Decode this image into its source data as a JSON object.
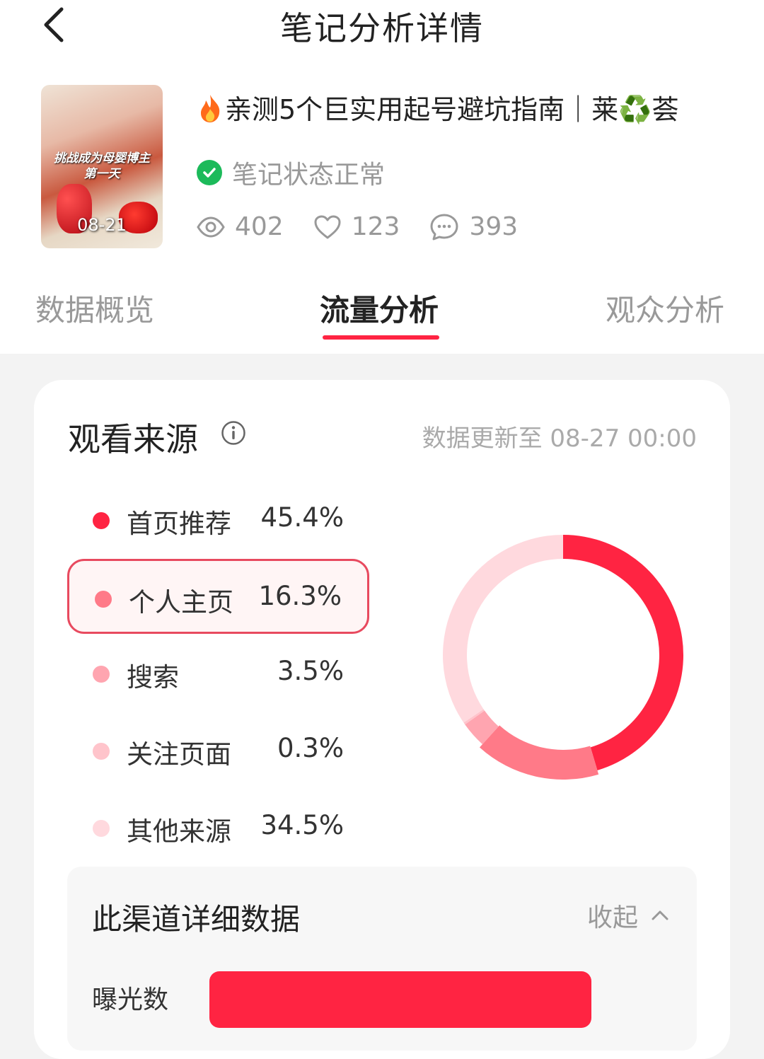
{
  "header": {
    "title": "笔记分析详情"
  },
  "note": {
    "thumbnail": {
      "caption_line1": "挑战成为母婴博主",
      "caption_line2": "第一天",
      "date": "08-21"
    },
    "title": "亲测5个巨实用起号避坑指南｜莱♻️荟",
    "status": "笔记状态正常",
    "stats": {
      "views": "402",
      "likes": "123",
      "comments": "393"
    }
  },
  "tabs": [
    {
      "label": "数据概览"
    },
    {
      "label": "流量分析"
    },
    {
      "label": "观众分析"
    }
  ],
  "active_tab_index": 1,
  "source": {
    "title": "观看来源",
    "updated": "数据更新至 08-27 00:00",
    "items": [
      {
        "label": "首页推荐",
        "value": "45.4%",
        "color": "#ff2442"
      },
      {
        "label": "个人主页",
        "value": "16.3%",
        "color": "#ff7a88"
      },
      {
        "label": "搜索",
        "value": "3.5%",
        "color": "#ffa5b0"
      },
      {
        "label": "关注页面",
        "value": "0.3%",
        "color": "#ffc4cb"
      },
      {
        "label": "其他来源",
        "value": "34.5%",
        "color": "#ffd9de"
      }
    ],
    "selected_index": 1
  },
  "chart_data": {
    "type": "pie",
    "categories": [
      "首页推荐",
      "个人主页",
      "搜索",
      "关注页面",
      "其他来源"
    ],
    "values": [
      45.4,
      16.3,
      3.5,
      0.3,
      34.5
    ],
    "colors": [
      "#ff2442",
      "#ff7a88",
      "#ffa5b0",
      "#ffc4cb",
      "#ffd9de"
    ]
  },
  "detail": {
    "title": "此渠道详细数据",
    "collapse_label": "收起",
    "exposure_label": "曝光数"
  },
  "colors": {
    "accent": "#ff2442",
    "success": "#1cba5a"
  }
}
